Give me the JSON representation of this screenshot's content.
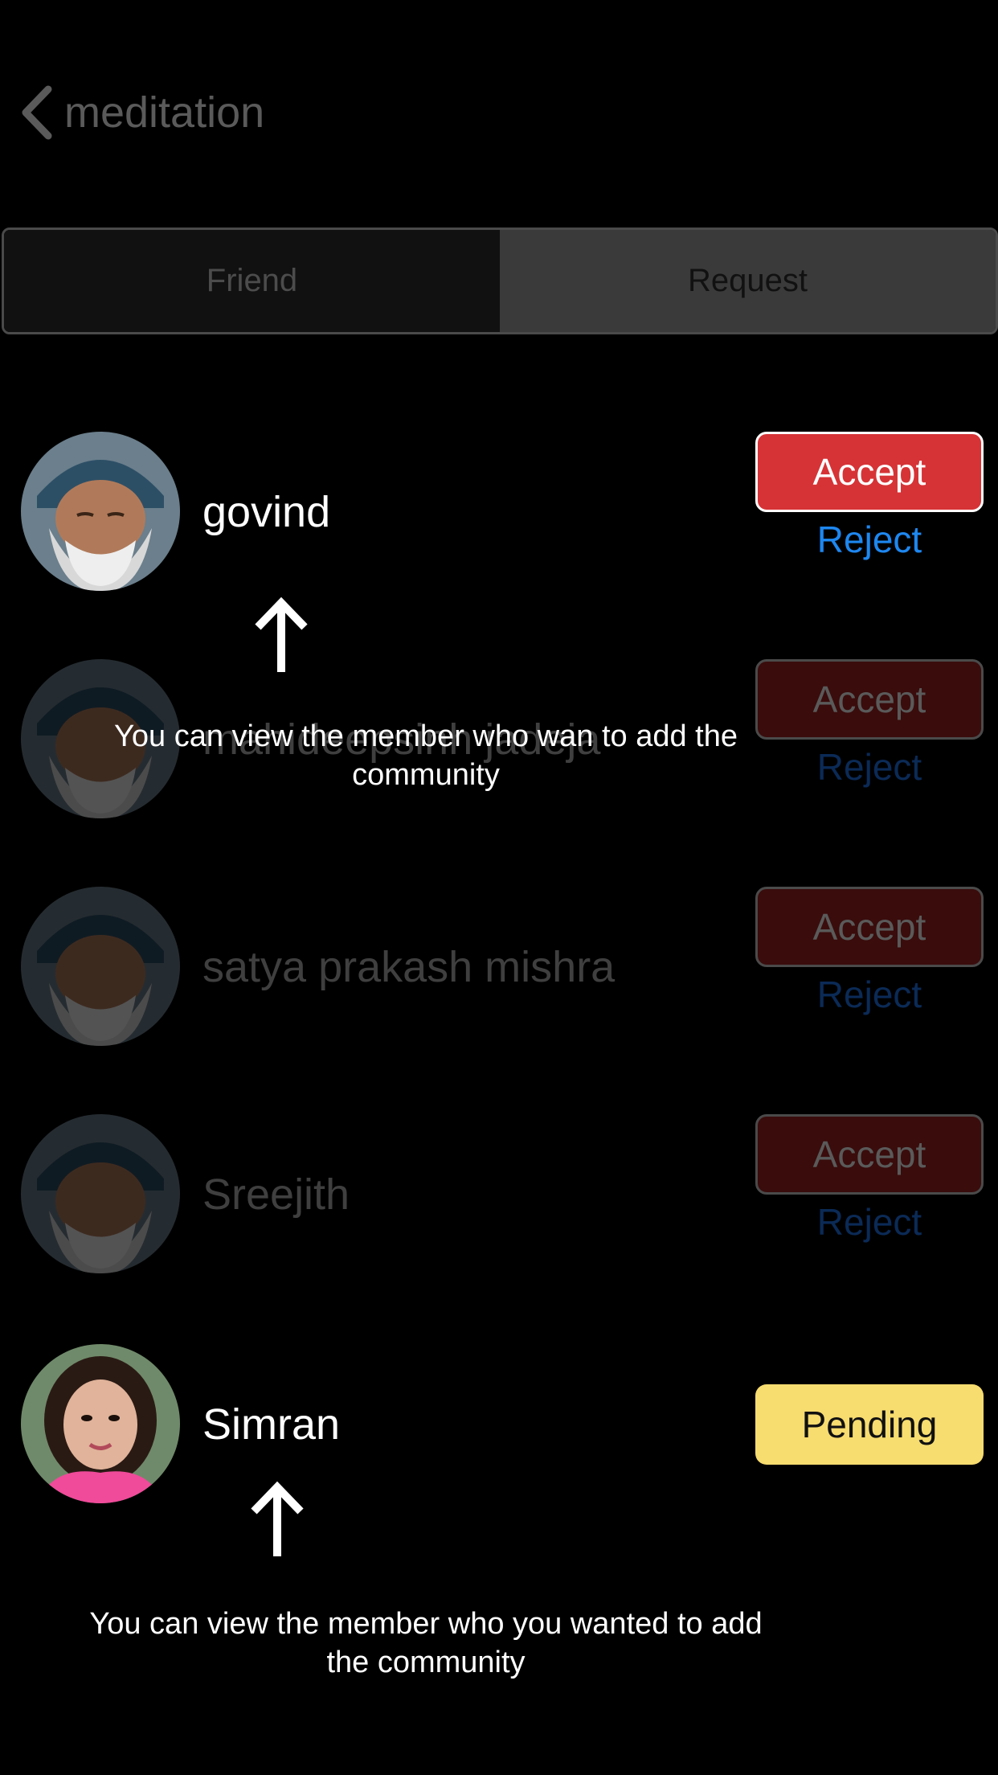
{
  "header": {
    "title": "meditation",
    "back_icon": "chevron-left-icon"
  },
  "tabs": [
    {
      "label": "Friend",
      "selected": false
    },
    {
      "label": "Request",
      "selected": true
    }
  ],
  "members": [
    {
      "name": "govind",
      "accept_label": "Accept",
      "reject_label": "Reject",
      "status": "incoming",
      "dimmed": false
    },
    {
      "name": "mahideepsinh jadeja",
      "accept_label": "Accept",
      "reject_label": "Reject",
      "status": "incoming",
      "dimmed": true
    },
    {
      "name": "satya prakash mishra",
      "accept_label": "Accept",
      "reject_label": "Reject",
      "status": "incoming",
      "dimmed": true
    },
    {
      "name": "Sreejith",
      "accept_label": "Accept",
      "reject_label": "Reject",
      "status": "incoming",
      "dimmed": true
    },
    {
      "name": "Simran",
      "pending_label": "Pending",
      "status": "pending",
      "dimmed": false
    }
  ],
  "hints": {
    "incoming": "You can view the member who wan to add the community",
    "pending": "You can view the member who you wanted to add the community"
  },
  "colors": {
    "background": "#000000",
    "accept": "#d63336",
    "reject": "#1e87f0",
    "pending": "#f7dc6f"
  }
}
